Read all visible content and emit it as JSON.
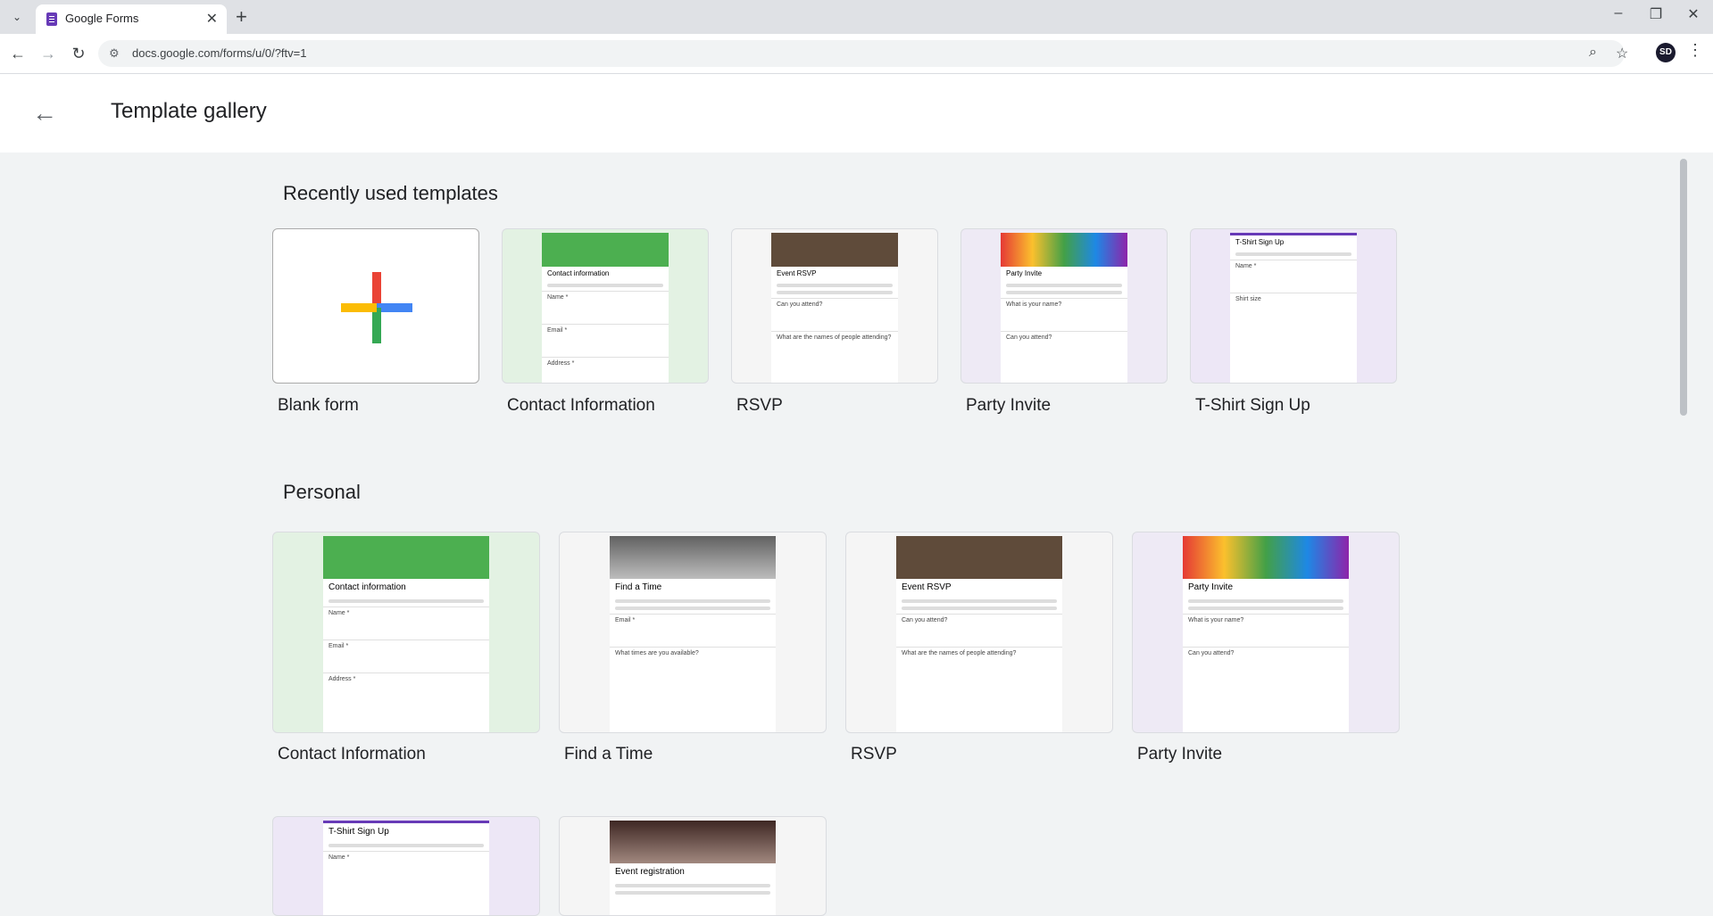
{
  "browser": {
    "tab_title": "Google Forms",
    "url": "docs.google.com/forms/u/0/?ftv=1",
    "ext_label": "SD"
  },
  "page": {
    "title": "Template gallery"
  },
  "sections": {
    "recent": {
      "title": "Recently used templates",
      "cards": [
        {
          "label": "Blank form"
        },
        {
          "label": "Contact Information",
          "thumb_title": "Contact information"
        },
        {
          "label": "RSVP",
          "thumb_title": "Event RSVP"
        },
        {
          "label": "Party Invite",
          "thumb_title": "Party Invite"
        },
        {
          "label": "T-Shirt Sign Up",
          "thumb_title": "T-Shirt Sign Up"
        }
      ]
    },
    "personal": {
      "title": "Personal",
      "cards": [
        {
          "label": "Contact Information",
          "thumb_title": "Contact information"
        },
        {
          "label": "Find a Time",
          "thumb_title": "Find a Time"
        },
        {
          "label": "RSVP",
          "thumb_title": "Event RSVP"
        },
        {
          "label": "Party Invite",
          "thumb_title": "Party Invite"
        },
        {
          "label": "",
          "thumb_title": "T-Shirt Sign Up"
        },
        {
          "label": "",
          "thumb_title": "Event registration"
        }
      ]
    }
  },
  "colors": {
    "contact": "#4caf50",
    "rsvp": "#5f4b3a",
    "party": "#6a5acd",
    "tshirt": "#673ab7",
    "find": "#424242",
    "event": "#8d6e63"
  }
}
